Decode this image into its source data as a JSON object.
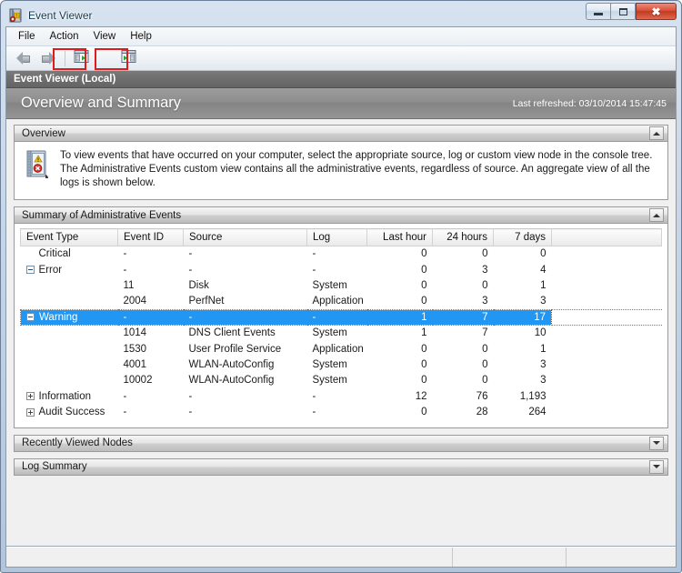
{
  "window": {
    "title": "Event Viewer",
    "icon": "event-viewer-icon",
    "controls": {
      "minimize": "Minimize",
      "maximize": "Maximize",
      "close": "Close"
    }
  },
  "menubar": {
    "items": [
      {
        "label": "File"
      },
      {
        "label": "Action"
      },
      {
        "label": "View"
      },
      {
        "label": "Help"
      }
    ]
  },
  "toolbar": {
    "back": "Back",
    "forward": "Forward",
    "show_hide_console_tree": "Show/Hide Console Tree",
    "show_hide_action_pane": "Show/Hide Action Pane",
    "annotation_color": "#e01b1b"
  },
  "scopebar": {
    "label": "Event Viewer (Local)"
  },
  "banner": {
    "title": "Overview and Summary",
    "refresh_label": "Last refreshed: 03/10/2014 15:47:45"
  },
  "panels": {
    "overview": {
      "title": "Overview",
      "expanded": true,
      "chevron": "chevron-up-icon",
      "body_text": "To view events that have occurred on your computer, select the appropriate source, log or custom view node in the console tree. The Administrative Events custom view contains all the administrative events, regardless of source. An aggregate view of all the logs is shown below."
    },
    "summary": {
      "title": "Summary of Administrative Events",
      "expanded": true,
      "chevron": "chevron-up-icon"
    },
    "recently_viewed": {
      "title": "Recently Viewed Nodes",
      "expanded": false,
      "chevron": "chevron-down-icon"
    },
    "log_summary": {
      "title": "Log Summary",
      "expanded": false,
      "chevron": "chevron-down-icon"
    }
  },
  "table": {
    "columns": [
      {
        "key": "event_type",
        "label": "Event Type",
        "align": "left"
      },
      {
        "key": "event_id",
        "label": "Event ID",
        "align": "left"
      },
      {
        "key": "source",
        "label": "Source",
        "align": "left"
      },
      {
        "key": "log",
        "label": "Log",
        "align": "left"
      },
      {
        "key": "last_hour",
        "label": "Last hour",
        "align": "right"
      },
      {
        "key": "hours_24",
        "label": "24 hours",
        "align": "right"
      },
      {
        "key": "days_7",
        "label": "7 days",
        "align": "right"
      },
      {
        "key": "pad",
        "label": "",
        "align": "left"
      }
    ],
    "rows": [
      {
        "level": 1,
        "toggle": "none",
        "selected": false,
        "event_type": "Critical",
        "event_id": "-",
        "source": "-",
        "log": "-",
        "last_hour": "0",
        "hours_24": "0",
        "days_7": "0"
      },
      {
        "level": 1,
        "toggle": "minus",
        "selected": false,
        "event_type": "Error",
        "event_id": "-",
        "source": "-",
        "log": "-",
        "last_hour": "0",
        "hours_24": "3",
        "days_7": "4"
      },
      {
        "level": 2,
        "toggle": "none",
        "selected": false,
        "event_type": "",
        "event_id": "11",
        "source": "Disk",
        "log": "System",
        "last_hour": "0",
        "hours_24": "0",
        "days_7": "1"
      },
      {
        "level": 2,
        "toggle": "none",
        "selected": false,
        "event_type": "",
        "event_id": "2004",
        "source": "PerfNet",
        "log": "Application",
        "last_hour": "0",
        "hours_24": "3",
        "days_7": "3"
      },
      {
        "level": 1,
        "toggle": "minus",
        "selected": true,
        "event_type": "Warning",
        "event_id": "-",
        "source": "-",
        "log": "-",
        "last_hour": "1",
        "hours_24": "7",
        "days_7": "17"
      },
      {
        "level": 2,
        "toggle": "none",
        "selected": false,
        "event_type": "",
        "event_id": "1014",
        "source": "DNS Client Events",
        "log": "System",
        "last_hour": "1",
        "hours_24": "7",
        "days_7": "10"
      },
      {
        "level": 2,
        "toggle": "none",
        "selected": false,
        "event_type": "",
        "event_id": "1530",
        "source": "User Profile Service",
        "log": "Application",
        "last_hour": "0",
        "hours_24": "0",
        "days_7": "1"
      },
      {
        "level": 2,
        "toggle": "none",
        "selected": false,
        "event_type": "",
        "event_id": "4001",
        "source": "WLAN-AutoConfig",
        "log": "System",
        "last_hour": "0",
        "hours_24": "0",
        "days_7": "3"
      },
      {
        "level": 2,
        "toggle": "none",
        "selected": false,
        "event_type": "",
        "event_id": "10002",
        "source": "WLAN-AutoConfig",
        "log": "System",
        "last_hour": "0",
        "hours_24": "0",
        "days_7": "3"
      },
      {
        "level": 1,
        "toggle": "plus",
        "selected": false,
        "event_type": "Information",
        "event_id": "-",
        "source": "-",
        "log": "-",
        "last_hour": "12",
        "hours_24": "76",
        "days_7": "1,193"
      },
      {
        "level": 1,
        "toggle": "plus",
        "selected": false,
        "event_type": "Audit Success",
        "event_id": "-",
        "source": "-",
        "log": "-",
        "last_hour": "0",
        "hours_24": "28",
        "days_7": "264"
      }
    ]
  },
  "statusbar": {
    "pane1": "",
    "pane2": "",
    "pane3": ""
  },
  "colors": {
    "selection": "#2196f3",
    "banner": "#8e8e8e",
    "scopebar": "#6e6e6e",
    "annotation": "#e01b1b"
  }
}
